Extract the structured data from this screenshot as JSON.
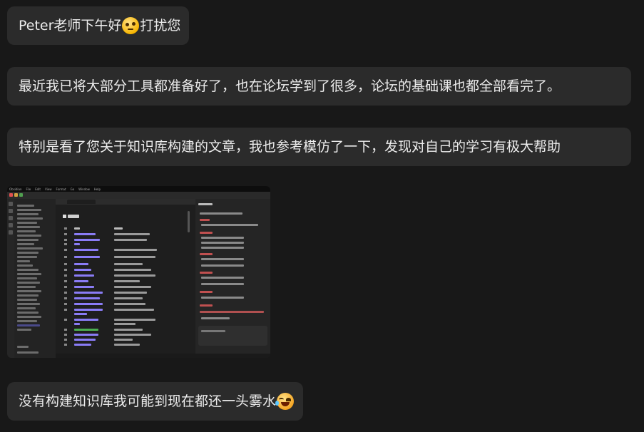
{
  "messages": [
    {
      "part1": "Peter老师下午好",
      "emoji1": "thinking-face-emoji",
      "part2": "打扰您"
    },
    {
      "text": "最近我已将大部分工具都准备好了，也在论坛学到了很多，论坛的基础课也都全部看完了。"
    },
    {
      "text": "特别是看了您关于知识库构建的文章，我也参考模仿了一下，发现对自己的学习有极大帮助"
    },
    {
      "image_label": "obsidian-knowledge-base-screenshot",
      "menubar": [
        "Obsidian",
        "File",
        "Edit",
        "View",
        "Format",
        "Go",
        "Window",
        "Help"
      ]
    },
    {
      "text": "没有构建知识库我可能到现在都还一头雾水",
      "emoji": "rolling-on-floor-laughing-emoji"
    }
  ],
  "colors": {
    "background": "#181818",
    "bubble": "#2b2b2b",
    "text": "#ececec",
    "link": "#8a7cf5"
  }
}
